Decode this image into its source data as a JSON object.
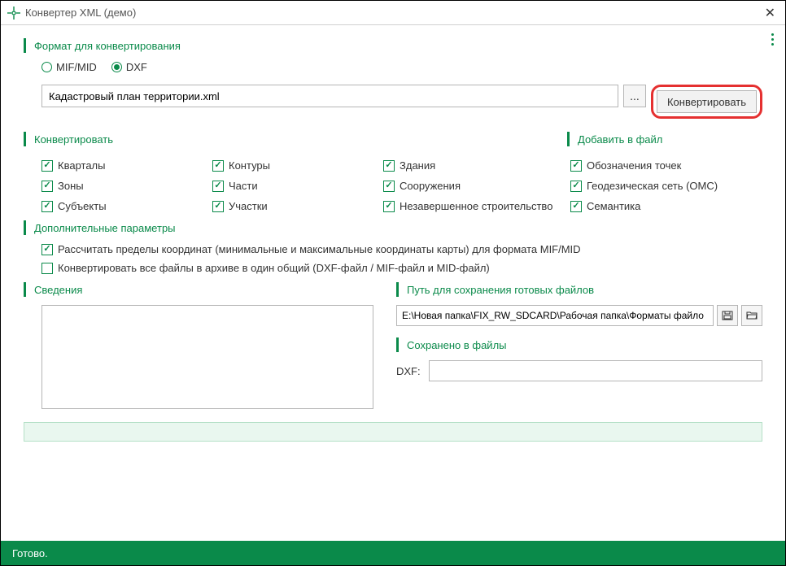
{
  "window": {
    "title": "Конвертер XML (демо)"
  },
  "sections": {
    "format": "Формат для конвертирования",
    "convert": "Конвертировать",
    "append": "Добавить в файл",
    "extra": "Дополнительные параметры",
    "info": "Сведения",
    "savepath": "Путь для сохранения готовых файлов",
    "saved": "Сохранено в файлы"
  },
  "radio": {
    "mifmid": "MIF/MID",
    "dxf": "DXF"
  },
  "fileInput": "Кадастровый план территории.xml",
  "browseLabel": "...",
  "convertButton": "Конвертировать",
  "checkboxes": {
    "quarters": "Кварталы",
    "zones": "Зоны",
    "subjects": "Субъекты",
    "contours": "Контуры",
    "parts": "Части",
    "parcels": "Участки",
    "buildings": "Здания",
    "constructions": "Сооружения",
    "unfinished": "Незавершенное строительство",
    "pointlabels": "Обозначения точек",
    "geodetic": "Геодезическая сеть (ОМС)",
    "semantics": "Семантика"
  },
  "params": {
    "calcBounds": "Рассчитать пределы координат (минимальные и максимальные координаты карты) для формата MIF/MID",
    "mergeArchive": "Конвертировать все файлы в архиве в один общий (DXF-файл / MIF-файл и MID-файл)"
  },
  "pathInput": "E:\\Новая папка\\FIX_RW_SDCARD\\Рабочая папка\\Форматы файло",
  "dxfLabel": "DXF:",
  "status": "Готово."
}
